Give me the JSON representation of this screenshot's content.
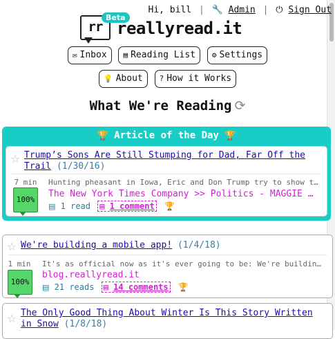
{
  "topbar": {
    "greeting": "Hi, bill",
    "admin_label": "Admin",
    "signout_label": "Sign Out"
  },
  "logo": {
    "bubble_text": "rr",
    "badge": "Beta",
    "text": "reallyread.it"
  },
  "nav": {
    "inbox": "Inbox",
    "reading_list": "Reading List",
    "settings": "Settings",
    "about": "About",
    "how_it_works": "How it Works"
  },
  "page_title": "What We're Reading",
  "article_of_day": {
    "title": "Article of the Day",
    "article": {
      "title": "Trump’s Sons Are Still Stumping for Dad, Far Off the Trail",
      "date": "(1/30/16)",
      "read_time": "7 min",
      "progress": "100%",
      "snippet": "Hunting pheasant in Iowa, Eric and Don Trump try to show th...",
      "source": "The New York Times Company >> Politics - MAGGIE HA...",
      "reads": "1 read",
      "comments": "1 comment"
    }
  },
  "articles": [
    {
      "title": "We're building a mobile app!",
      "date": "(1/4/18)",
      "read_time": "1 min",
      "progress": "100%",
      "snippet": "It's as official now as it's ever going to be: We're building...",
      "source": "blog.reallyread.it",
      "reads": "21 reads",
      "comments": "14 comments"
    },
    {
      "title": "The Only Good Thing About Winter Is This Story Written in Snow",
      "date": "(1/8/18)"
    }
  ],
  "colors": {
    "accent": "#19cdc7",
    "link": "#1a0dab",
    "source": "#d21fd4",
    "progress": "#55d668"
  }
}
